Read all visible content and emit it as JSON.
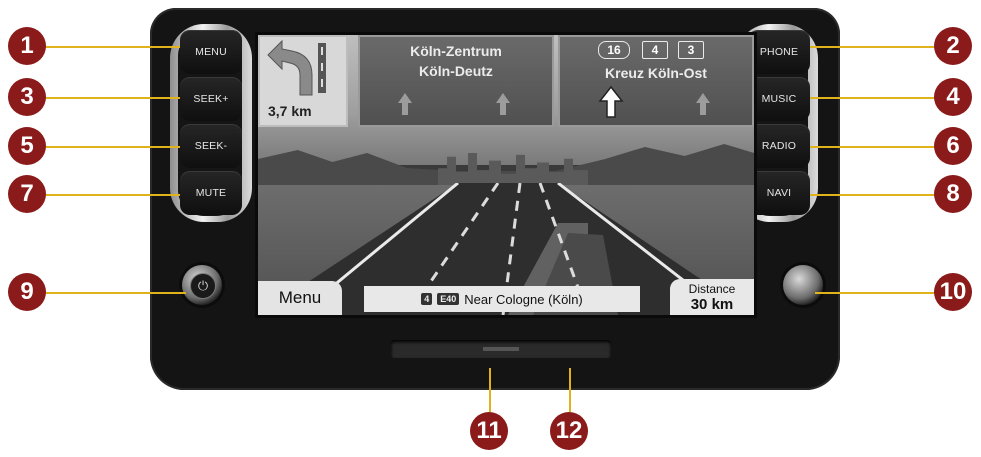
{
  "buttons": {
    "menu": "MENU",
    "seek_plus": "SEEK+",
    "seek_minus": "SEEK-",
    "mute": "MUTE",
    "phone": "PHONE",
    "music": "MUSIC",
    "radio": "RADIO",
    "navi": "NAVI"
  },
  "screen": {
    "turn_distance": "3,7 km",
    "sign_left_line1": "Köln-Zentrum",
    "sign_left_line2": "Köln-Deutz",
    "sign_right_route1": "16",
    "sign_right_route2": "4",
    "sign_right_route3": "3",
    "sign_right_text": "Kreuz Köln-Ost",
    "menu_button": "Menu",
    "street_route": "4",
    "street_euro": "E40",
    "street_name": "Near Cologne (Köln)",
    "distance_label": "Distance",
    "distance_value": "30 km"
  },
  "callouts": [
    "1",
    "2",
    "3",
    "4",
    "5",
    "6",
    "7",
    "8",
    "9",
    "10",
    "11",
    "12"
  ],
  "colors": {
    "callout_badge": "#8b1a1a",
    "leader_line": "#e0b21b"
  },
  "icons": {
    "left_knob": "power-icon",
    "turn_sign": "turn-arrow-icon"
  }
}
